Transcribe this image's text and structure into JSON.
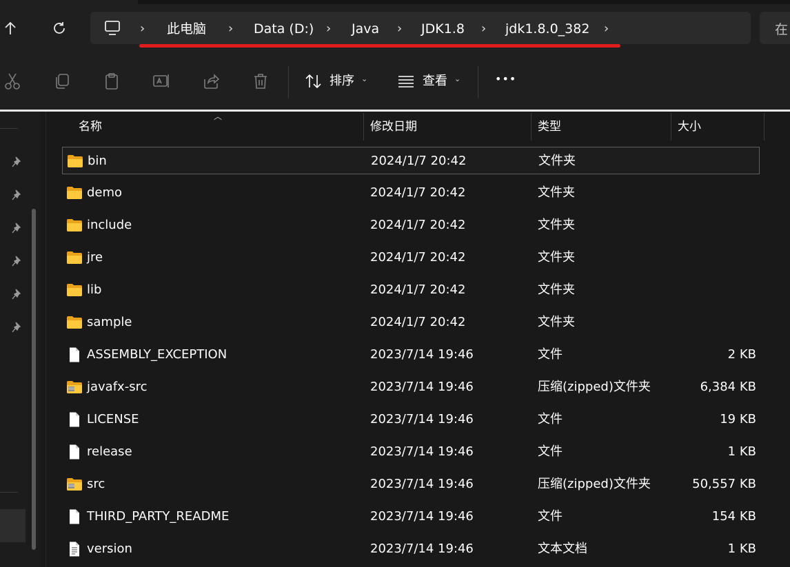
{
  "address_bar": {
    "breadcrumbs": [
      "此电脑",
      "Data (D:)",
      "Java",
      "JDK1.8",
      "jdk1.8.0_382"
    ],
    "search_placeholder": "在",
    "underline_color": "#e01d1d"
  },
  "nav_buttons": {
    "up_icon": "arrow-up-icon",
    "refresh_icon": "refresh-icon"
  },
  "toolbar": {
    "sort_label": "排序",
    "view_label": "查看",
    "more_label": "•••",
    "icons": [
      "cut-icon",
      "copy-icon",
      "paste-icon",
      "rename-icon",
      "share-icon",
      "delete-icon"
    ]
  },
  "columns": {
    "name": "名称",
    "date": "修改日期",
    "type": "类型",
    "size": "大小"
  },
  "files": [
    {
      "name": "bin",
      "date": "2024/1/7 20:42",
      "type": "文件夹",
      "size": "",
      "icon": "folder-icon",
      "selected": true
    },
    {
      "name": "demo",
      "date": "2024/1/7 20:42",
      "type": "文件夹",
      "size": "",
      "icon": "folder-icon"
    },
    {
      "name": "include",
      "date": "2024/1/7 20:42",
      "type": "文件夹",
      "size": "",
      "icon": "folder-icon"
    },
    {
      "name": "jre",
      "date": "2024/1/7 20:42",
      "type": "文件夹",
      "size": "",
      "icon": "folder-icon"
    },
    {
      "name": "lib",
      "date": "2024/1/7 20:42",
      "type": "文件夹",
      "size": "",
      "icon": "folder-icon"
    },
    {
      "name": "sample",
      "date": "2024/1/7 20:42",
      "type": "文件夹",
      "size": "",
      "icon": "folder-icon"
    },
    {
      "name": "ASSEMBLY_EXCEPTION",
      "date": "2023/7/14 19:46",
      "type": "文件",
      "size": "2 KB",
      "icon": "file-icon"
    },
    {
      "name": "javafx-src",
      "date": "2023/7/14 19:46",
      "type": "压缩(zipped)文件夹",
      "size": "6,384 KB",
      "icon": "zip-folder-icon"
    },
    {
      "name": "LICENSE",
      "date": "2023/7/14 19:46",
      "type": "文件",
      "size": "19 KB",
      "icon": "file-icon"
    },
    {
      "name": "release",
      "date": "2023/7/14 19:46",
      "type": "文件",
      "size": "1 KB",
      "icon": "file-icon"
    },
    {
      "name": "src",
      "date": "2023/7/14 19:46",
      "type": "压缩(zipped)文件夹",
      "size": "50,557 KB",
      "icon": "zip-folder-icon"
    },
    {
      "name": "THIRD_PARTY_README",
      "date": "2023/7/14 19:46",
      "type": "文件",
      "size": "154 KB",
      "icon": "file-icon"
    },
    {
      "name": "version",
      "date": "2023/7/14 19:46",
      "type": "文本文档",
      "size": "1 KB",
      "icon": "text-file-icon"
    }
  ]
}
